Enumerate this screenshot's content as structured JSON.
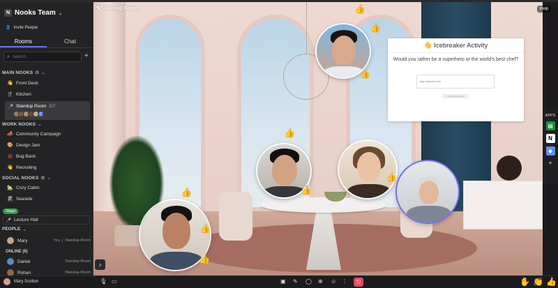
{
  "app": {
    "team_name": "Nooks Team",
    "invite_label": "Invite People",
    "room_title": "Standup Room",
    "help_label": "Help"
  },
  "tabs": [
    {
      "label": "Rooms",
      "active": true
    },
    {
      "label": "Chat",
      "active": false
    }
  ],
  "search": {
    "placeholder": "Search"
  },
  "sections": {
    "main": {
      "title": "MAIN NOOKS",
      "rooms": [
        {
          "label": "Front Desk",
          "icon": "wave-icon"
        },
        {
          "label": "Kitchen",
          "icon": "utensils-icon"
        }
      ],
      "active_room": {
        "label": "Standup Room",
        "count": "5/7",
        "extra_badge": "C"
      }
    },
    "work": {
      "title": "WORK NOOKS",
      "rooms": [
        {
          "label": "Community Campaign",
          "icon": "megaphone-icon"
        },
        {
          "label": "Design Jam",
          "icon": "palette-icon"
        },
        {
          "label": "Bug Bash",
          "icon": "bug-icon"
        },
        {
          "label": "Recruiting",
          "icon": "wave-icon"
        }
      ]
    },
    "social": {
      "title": "SOCIAL NOOKS",
      "rooms": [
        {
          "label": "Cozy Cabin",
          "icon": "cabin-icon"
        },
        {
          "label": "Seaside",
          "icon": "seaside-icon"
        }
      ]
    },
    "stage": {
      "badge": "Stage",
      "room": "Lecture Hall"
    },
    "people": {
      "title": "PEOPLE",
      "me": {
        "name": "Mary",
        "you_label": "You",
        "room": "Standup Room"
      },
      "online_title": "ONLINE (6)",
      "online": [
        {
          "name": "Daniel",
          "room": "Standup Room"
        },
        {
          "name": "Rohan",
          "room": "Standup Room"
        }
      ]
    }
  },
  "card": {
    "title": "Icebreaker Activity",
    "title_icon": "wave-icon",
    "question": "Would you rather be a superhero or the world's best chef?",
    "input_placeholder": "Type response here",
    "submit_label": "Submit Response"
  },
  "apps_rail": {
    "label": "APPS",
    "apps": [
      "sheets-icon",
      "notion-icon",
      "cube-icon",
      "plus-icon"
    ]
  },
  "user": {
    "name": "Mary Scotton"
  },
  "reactions": [
    "raised-hand-icon",
    "clapping-hands-icon",
    "thumbs-up-icon"
  ],
  "colors": {
    "accent": "#6f6cf0",
    "leave": "#e04a5f",
    "stage": "#2e9e44",
    "sidebar_bg": "#232325"
  }
}
